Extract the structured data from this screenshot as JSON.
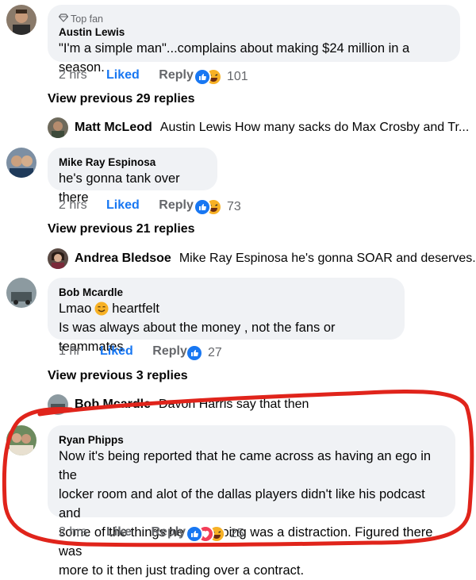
{
  "comments": [
    {
      "badge": "Top fan",
      "author": "Austin Lewis",
      "text": "\"I'm a simple man\"...complains about making $24 million in a season.",
      "time": "2 hrs",
      "like_label": "Liked",
      "reply_label": "Reply",
      "reaction_count": "101"
    },
    {
      "author": "Mike Ray Espinosa",
      "text": "he's gonna tank over there",
      "time": "2 hrs",
      "like_label": "Liked",
      "reply_label": "Reply",
      "reaction_count": "73"
    },
    {
      "author": "Bob Mcardle",
      "text_line1_a": "Lmao",
      "text_line1_b": "heartfelt",
      "text_line2": "Is was always about the money , not the fans or teammates",
      "time": "1 hr",
      "like_label": "Liked",
      "reply_label": "Reply",
      "reaction_count": "27"
    },
    {
      "author": "Ryan Phipps",
      "text_lines": [
        "Now it's being reported that he came across as having an ego in the",
        "locker room and alot of the dallas players didn't like his podcast and",
        "some of the things he was doing was a distraction. Figured there was",
        "more to it then just trading over a contract."
      ],
      "time": "2 hrs",
      "like_label": "Like",
      "reply_label": "Reply",
      "reaction_count": "25"
    }
  ],
  "view_previous": [
    "View previous 29 replies",
    "View previous 21 replies",
    "View previous 3 replies"
  ],
  "reply_previews": [
    {
      "author": "Matt McLeod",
      "text": "Austin Lewis How many sacks do Max Crosby and Tr..."
    },
    {
      "author": "Andrea Bledsoe",
      "text": "Mike Ray Espinosa he's gonna SOAR and deserves..."
    },
    {
      "author": "Bob Mcardle",
      "text": "Davon Harris say that then"
    }
  ],
  "icons": {
    "badge": "diamond-icon",
    "like": "like-reaction-icon",
    "haha": "haha-reaction-icon",
    "love": "love-reaction-icon",
    "emoji": "smile-emoji-icon"
  },
  "colors": {
    "liked": "#1877f2",
    "meta": "#65676b",
    "bubble": "#f0f2f5",
    "highlight": "#e0241b"
  }
}
